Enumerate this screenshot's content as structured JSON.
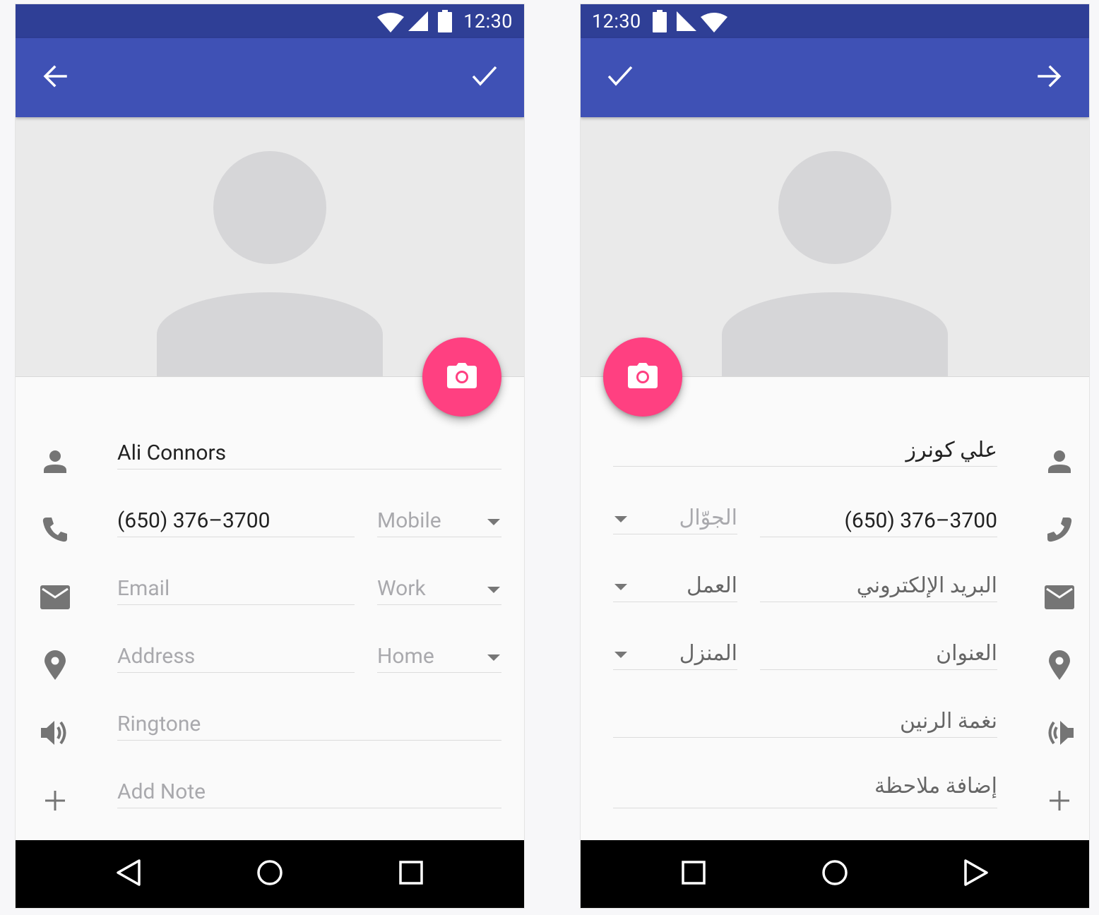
{
  "colors": {
    "status_bar": "#2f3f96",
    "app_bar": "#3f51b5",
    "fab": "#ff4081",
    "nav_bar": "#000000",
    "photo_bg": "#eaeaea"
  },
  "ltr_screen": {
    "status": {
      "time": "12:30",
      "icons": [
        "wifi-icon",
        "signal-icon",
        "battery-icon"
      ]
    },
    "app_bar": {
      "left_action_icon": "arrow-back-icon",
      "right_action_icon": "check-icon"
    },
    "fab_icon": "camera-icon",
    "fields": {
      "name": {
        "icon": "person-icon",
        "value": "Ali Connors"
      },
      "phone": {
        "icon": "phone-icon",
        "value": "(650) 376–3700",
        "type": "Mobile"
      },
      "email": {
        "icon": "email-icon",
        "placeholder": "Email",
        "type": "Work"
      },
      "address": {
        "icon": "location-pin-icon",
        "placeholder": "Address",
        "type": "Home"
      },
      "ringtone": {
        "icon": "volume-icon",
        "placeholder": "Ringtone"
      },
      "note": {
        "icon": "add-icon",
        "placeholder": "Add Note"
      }
    },
    "nav": [
      "back-icon",
      "home-icon",
      "recents-icon"
    ]
  },
  "rtl_screen": {
    "status": {
      "time": "12:30",
      "icons": [
        "battery-icon",
        "signal-icon",
        "wifi-icon"
      ]
    },
    "app_bar": {
      "left_action_icon": "check-icon",
      "right_action_icon": "arrow-forward-icon"
    },
    "fab_icon": "camera-icon",
    "fields": {
      "name": {
        "icon": "person-icon",
        "value": "علي كونرز"
      },
      "phone": {
        "icon": "phone-icon",
        "value": "(650) 376–3700",
        "type": "الجوّال"
      },
      "email": {
        "icon": "email-icon",
        "placeholder": "البريد الإلكتروني",
        "type": "العمل"
      },
      "address": {
        "icon": "location-pin-icon",
        "placeholder": "العنوان",
        "type": "المنزل"
      },
      "ringtone": {
        "icon": "volume-icon",
        "placeholder": "نغمة الرنين"
      },
      "note": {
        "icon": "add-icon",
        "placeholder": "إضافة ملاحظة"
      }
    },
    "nav": [
      "recents-icon",
      "home-icon",
      "back-icon"
    ]
  }
}
